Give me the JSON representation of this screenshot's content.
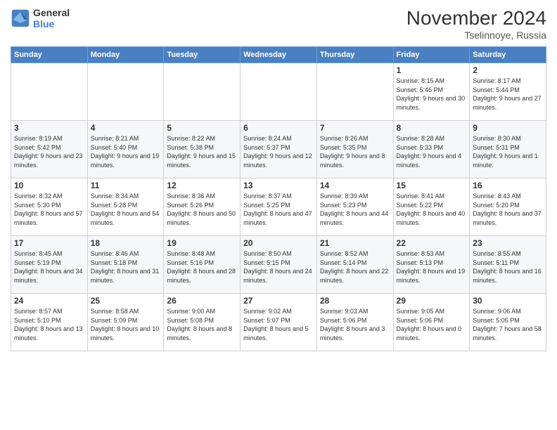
{
  "logo": {
    "line1": "General",
    "line2": "Blue"
  },
  "title": "November 2024",
  "location": "Tselinnoye, Russia",
  "days_of_week": [
    "Sunday",
    "Monday",
    "Tuesday",
    "Wednesday",
    "Thursday",
    "Friday",
    "Saturday"
  ],
  "weeks": [
    [
      {
        "day": "",
        "info": ""
      },
      {
        "day": "",
        "info": ""
      },
      {
        "day": "",
        "info": ""
      },
      {
        "day": "",
        "info": ""
      },
      {
        "day": "",
        "info": ""
      },
      {
        "day": "1",
        "info": "Sunrise: 8:15 AM\nSunset: 5:46 PM\nDaylight: 9 hours and 30 minutes."
      },
      {
        "day": "2",
        "info": "Sunrise: 8:17 AM\nSunset: 5:44 PM\nDaylight: 9 hours and 27 minutes."
      }
    ],
    [
      {
        "day": "3",
        "info": "Sunrise: 8:19 AM\nSunset: 5:42 PM\nDaylight: 9 hours and 23 minutes."
      },
      {
        "day": "4",
        "info": "Sunrise: 8:21 AM\nSunset: 5:40 PM\nDaylight: 9 hours and 19 minutes."
      },
      {
        "day": "5",
        "info": "Sunrise: 8:22 AM\nSunset: 5:38 PM\nDaylight: 9 hours and 15 minutes."
      },
      {
        "day": "6",
        "info": "Sunrise: 8:24 AM\nSunset: 5:37 PM\nDaylight: 9 hours and 12 minutes."
      },
      {
        "day": "7",
        "info": "Sunrise: 8:26 AM\nSunset: 5:35 PM\nDaylight: 9 hours and 8 minutes."
      },
      {
        "day": "8",
        "info": "Sunrise: 8:28 AM\nSunset: 5:33 PM\nDaylight: 9 hours and 4 minutes."
      },
      {
        "day": "9",
        "info": "Sunrise: 8:30 AM\nSunset: 5:31 PM\nDaylight: 9 hours and 1 minute."
      }
    ],
    [
      {
        "day": "10",
        "info": "Sunrise: 8:32 AM\nSunset: 5:30 PM\nDaylight: 8 hours and 57 minutes."
      },
      {
        "day": "11",
        "info": "Sunrise: 8:34 AM\nSunset: 5:28 PM\nDaylight: 8 hours and 54 minutes."
      },
      {
        "day": "12",
        "info": "Sunrise: 8:36 AM\nSunset: 5:26 PM\nDaylight: 8 hours and 50 minutes."
      },
      {
        "day": "13",
        "info": "Sunrise: 8:37 AM\nSunset: 5:25 PM\nDaylight: 8 hours and 47 minutes."
      },
      {
        "day": "14",
        "info": "Sunrise: 8:39 AM\nSunset: 5:23 PM\nDaylight: 8 hours and 44 minutes."
      },
      {
        "day": "15",
        "info": "Sunrise: 8:41 AM\nSunset: 5:22 PM\nDaylight: 8 hours and 40 minutes."
      },
      {
        "day": "16",
        "info": "Sunrise: 8:43 AM\nSunset: 5:20 PM\nDaylight: 8 hours and 37 minutes."
      }
    ],
    [
      {
        "day": "17",
        "info": "Sunrise: 8:45 AM\nSunset: 5:19 PM\nDaylight: 8 hours and 34 minutes."
      },
      {
        "day": "18",
        "info": "Sunrise: 8:46 AM\nSunset: 5:18 PM\nDaylight: 8 hours and 31 minutes."
      },
      {
        "day": "19",
        "info": "Sunrise: 8:48 AM\nSunset: 5:16 PM\nDaylight: 8 hours and 28 minutes."
      },
      {
        "day": "20",
        "info": "Sunrise: 8:50 AM\nSunset: 5:15 PM\nDaylight: 8 hours and 24 minutes."
      },
      {
        "day": "21",
        "info": "Sunrise: 8:52 AM\nSunset: 5:14 PM\nDaylight: 8 hours and 22 minutes."
      },
      {
        "day": "22",
        "info": "Sunrise: 8:53 AM\nSunset: 5:13 PM\nDaylight: 8 hours and 19 minutes."
      },
      {
        "day": "23",
        "info": "Sunrise: 8:55 AM\nSunset: 5:11 PM\nDaylight: 8 hours and 16 minutes."
      }
    ],
    [
      {
        "day": "24",
        "info": "Sunrise: 8:57 AM\nSunset: 5:10 PM\nDaylight: 8 hours and 13 minutes."
      },
      {
        "day": "25",
        "info": "Sunrise: 8:58 AM\nSunset: 5:09 PM\nDaylight: 8 hours and 10 minutes."
      },
      {
        "day": "26",
        "info": "Sunrise: 9:00 AM\nSunset: 5:08 PM\nDaylight: 8 hours and 8 minutes."
      },
      {
        "day": "27",
        "info": "Sunrise: 9:02 AM\nSunset: 5:07 PM\nDaylight: 8 hours and 5 minutes."
      },
      {
        "day": "28",
        "info": "Sunrise: 9:03 AM\nSunset: 5:06 PM\nDaylight: 8 hours and 3 minutes."
      },
      {
        "day": "29",
        "info": "Sunrise: 9:05 AM\nSunset: 5:06 PM\nDaylight: 8 hours and 0 minutes."
      },
      {
        "day": "30",
        "info": "Sunrise: 9:06 AM\nSunset: 5:05 PM\nDaylight: 7 hours and 58 minutes."
      }
    ]
  ]
}
